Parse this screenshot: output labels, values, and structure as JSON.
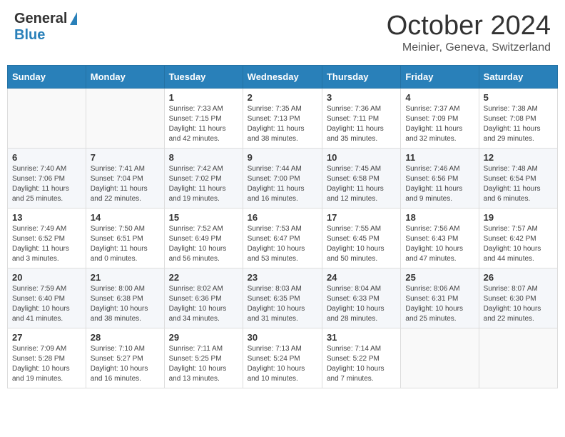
{
  "header": {
    "logo_general": "General",
    "logo_blue": "Blue",
    "month_title": "October 2024",
    "location": "Meinier, Geneva, Switzerland"
  },
  "calendar": {
    "days_of_week": [
      "Sunday",
      "Monday",
      "Tuesday",
      "Wednesday",
      "Thursday",
      "Friday",
      "Saturday"
    ],
    "weeks": [
      [
        {
          "day": "",
          "info": ""
        },
        {
          "day": "",
          "info": ""
        },
        {
          "day": "1",
          "info": "Sunrise: 7:33 AM\nSunset: 7:15 PM\nDaylight: 11 hours and 42 minutes."
        },
        {
          "day": "2",
          "info": "Sunrise: 7:35 AM\nSunset: 7:13 PM\nDaylight: 11 hours and 38 minutes."
        },
        {
          "day": "3",
          "info": "Sunrise: 7:36 AM\nSunset: 7:11 PM\nDaylight: 11 hours and 35 minutes."
        },
        {
          "day": "4",
          "info": "Sunrise: 7:37 AM\nSunset: 7:09 PM\nDaylight: 11 hours and 32 minutes."
        },
        {
          "day": "5",
          "info": "Sunrise: 7:38 AM\nSunset: 7:08 PM\nDaylight: 11 hours and 29 minutes."
        }
      ],
      [
        {
          "day": "6",
          "info": "Sunrise: 7:40 AM\nSunset: 7:06 PM\nDaylight: 11 hours and 25 minutes."
        },
        {
          "day": "7",
          "info": "Sunrise: 7:41 AM\nSunset: 7:04 PM\nDaylight: 11 hours and 22 minutes."
        },
        {
          "day": "8",
          "info": "Sunrise: 7:42 AM\nSunset: 7:02 PM\nDaylight: 11 hours and 19 minutes."
        },
        {
          "day": "9",
          "info": "Sunrise: 7:44 AM\nSunset: 7:00 PM\nDaylight: 11 hours and 16 minutes."
        },
        {
          "day": "10",
          "info": "Sunrise: 7:45 AM\nSunset: 6:58 PM\nDaylight: 11 hours and 12 minutes."
        },
        {
          "day": "11",
          "info": "Sunrise: 7:46 AM\nSunset: 6:56 PM\nDaylight: 11 hours and 9 minutes."
        },
        {
          "day": "12",
          "info": "Sunrise: 7:48 AM\nSunset: 6:54 PM\nDaylight: 11 hours and 6 minutes."
        }
      ],
      [
        {
          "day": "13",
          "info": "Sunrise: 7:49 AM\nSunset: 6:52 PM\nDaylight: 11 hours and 3 minutes."
        },
        {
          "day": "14",
          "info": "Sunrise: 7:50 AM\nSunset: 6:51 PM\nDaylight: 11 hours and 0 minutes."
        },
        {
          "day": "15",
          "info": "Sunrise: 7:52 AM\nSunset: 6:49 PM\nDaylight: 10 hours and 56 minutes."
        },
        {
          "day": "16",
          "info": "Sunrise: 7:53 AM\nSunset: 6:47 PM\nDaylight: 10 hours and 53 minutes."
        },
        {
          "day": "17",
          "info": "Sunrise: 7:55 AM\nSunset: 6:45 PM\nDaylight: 10 hours and 50 minutes."
        },
        {
          "day": "18",
          "info": "Sunrise: 7:56 AM\nSunset: 6:43 PM\nDaylight: 10 hours and 47 minutes."
        },
        {
          "day": "19",
          "info": "Sunrise: 7:57 AM\nSunset: 6:42 PM\nDaylight: 10 hours and 44 minutes."
        }
      ],
      [
        {
          "day": "20",
          "info": "Sunrise: 7:59 AM\nSunset: 6:40 PM\nDaylight: 10 hours and 41 minutes."
        },
        {
          "day": "21",
          "info": "Sunrise: 8:00 AM\nSunset: 6:38 PM\nDaylight: 10 hours and 38 minutes."
        },
        {
          "day": "22",
          "info": "Sunrise: 8:02 AM\nSunset: 6:36 PM\nDaylight: 10 hours and 34 minutes."
        },
        {
          "day": "23",
          "info": "Sunrise: 8:03 AM\nSunset: 6:35 PM\nDaylight: 10 hours and 31 minutes."
        },
        {
          "day": "24",
          "info": "Sunrise: 8:04 AM\nSunset: 6:33 PM\nDaylight: 10 hours and 28 minutes."
        },
        {
          "day": "25",
          "info": "Sunrise: 8:06 AM\nSunset: 6:31 PM\nDaylight: 10 hours and 25 minutes."
        },
        {
          "day": "26",
          "info": "Sunrise: 8:07 AM\nSunset: 6:30 PM\nDaylight: 10 hours and 22 minutes."
        }
      ],
      [
        {
          "day": "27",
          "info": "Sunrise: 7:09 AM\nSunset: 5:28 PM\nDaylight: 10 hours and 19 minutes."
        },
        {
          "day": "28",
          "info": "Sunrise: 7:10 AM\nSunset: 5:27 PM\nDaylight: 10 hours and 16 minutes."
        },
        {
          "day": "29",
          "info": "Sunrise: 7:11 AM\nSunset: 5:25 PM\nDaylight: 10 hours and 13 minutes."
        },
        {
          "day": "30",
          "info": "Sunrise: 7:13 AM\nSunset: 5:24 PM\nDaylight: 10 hours and 10 minutes."
        },
        {
          "day": "31",
          "info": "Sunrise: 7:14 AM\nSunset: 5:22 PM\nDaylight: 10 hours and 7 minutes."
        },
        {
          "day": "",
          "info": ""
        },
        {
          "day": "",
          "info": ""
        }
      ]
    ]
  }
}
